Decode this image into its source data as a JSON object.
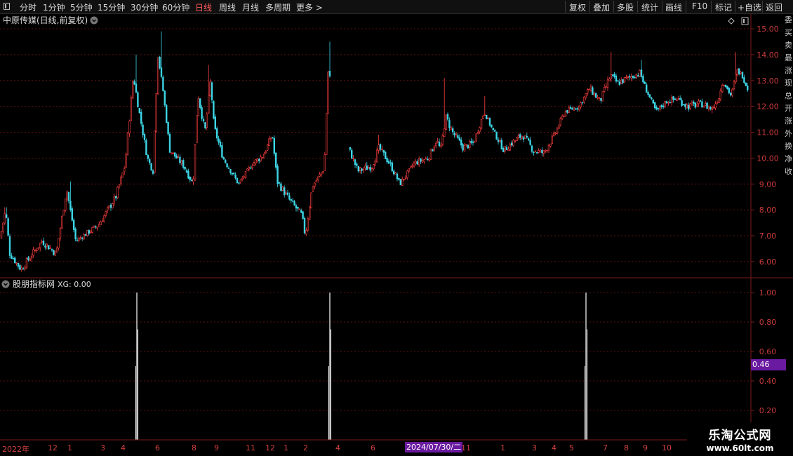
{
  "toolbar": {
    "left_items": [
      "分时",
      "1分钟",
      "5分钟",
      "15分钟",
      "30分钟",
      "60分钟",
      "日线",
      "周线",
      "月线",
      "多周期",
      "更多 >"
    ],
    "active": "日线",
    "right_items": [
      "复权",
      "叠加",
      "多股",
      "统计",
      "画线",
      "F10",
      "标记",
      "+自选",
      "返回"
    ]
  },
  "main_panel": {
    "title": "中原传媒(日线,前复权)",
    "y_ticks": [
      "15.00",
      "14.00",
      "13.00",
      "12.00",
      "11.00",
      "10.00",
      "9.00",
      "8.00",
      "7.00",
      "6.00"
    ]
  },
  "indicator_panel": {
    "title": "股朋指标网",
    "value_label": "XG: 0.00",
    "y_ticks": [
      "1.00",
      "0.80",
      "0.60",
      "0.40",
      "0.20"
    ],
    "cursor_value": "0.46"
  },
  "x_axis": {
    "labels": [
      "2022年",
      "12",
      "1",
      "3",
      "4",
      "6",
      "8",
      "9",
      "11",
      "12",
      "1",
      "2",
      "4",
      "6",
      "11",
      "1",
      "3",
      "4",
      "5",
      "7",
      "8",
      "9",
      "10"
    ],
    "cursor_date": "2024/07/30/二"
  },
  "right_side_labels": [
    "委",
    "买",
    "卖",
    "最",
    "涨",
    "现",
    "总",
    "开",
    "涨",
    "外",
    "换",
    "净",
    "收"
  ],
  "watermark": {
    "title": "乐淘公式网",
    "url": "www.60lt.com"
  },
  "colors": {
    "up": "#ff4040",
    "down": "#3cd6e6",
    "grid": "#5a1010",
    "signal": "#ffffff",
    "accent": "#6a1aa0"
  },
  "chart_data": [
    {
      "type": "candlestick",
      "title": "中原传媒(日线,前复权)",
      "ylim": [
        5.4,
        15.3
      ],
      "x_labels": [
        "2022年",
        "12",
        "1",
        "3",
        "4",
        "6",
        "8",
        "9",
        "11",
        "12",
        "1",
        "2",
        "4",
        "6",
        "11",
        "1",
        "3",
        "4",
        "5",
        "7",
        "8",
        "9",
        "10"
      ],
      "close_keypoints": [
        [
          0,
          6.9
        ],
        [
          8,
          8.0
        ],
        [
          14,
          6.3
        ],
        [
          30,
          5.7
        ],
        [
          60,
          6.8
        ],
        [
          80,
          6.3
        ],
        [
          95,
          8.8
        ],
        [
          108,
          6.8
        ],
        [
          140,
          7.4
        ],
        [
          165,
          8.5
        ],
        [
          178,
          9.7
        ],
        [
          190,
          13.2
        ],
        [
          197,
          12.0
        ],
        [
          210,
          10.0
        ],
        [
          218,
          9.5
        ],
        [
          225,
          14.0
        ],
        [
          232,
          12.7
        ],
        [
          242,
          10.3
        ],
        [
          262,
          9.7
        ],
        [
          275,
          9.0
        ],
        [
          282,
          12.5
        ],
        [
          292,
          11.0
        ],
        [
          300,
          13.0
        ],
        [
          305,
          11.2
        ],
        [
          318,
          10.0
        ],
        [
          340,
          9.0
        ],
        [
          360,
          9.8
        ],
        [
          375,
          10.1
        ],
        [
          388,
          10.9
        ],
        [
          395,
          9.1
        ],
        [
          412,
          8.4
        ],
        [
          430,
          7.8
        ],
        [
          435,
          7.0
        ],
        [
          445,
          8.9
        ],
        [
          462,
          9.6
        ],
        [
          468,
          13.6
        ],
        [
          475,
          12.0
        ],
        [
          488,
          11.0
        ],
        [
          495,
          10.5
        ],
        [
          510,
          9.5
        ],
        [
          530,
          9.7
        ],
        [
          540,
          10.4
        ],
        [
          555,
          9.8
        ],
        [
          570,
          9.0
        ],
        [
          590,
          9.8
        ],
        [
          610,
          10.0
        ],
        [
          622,
          10.7
        ],
        [
          628,
          10.3
        ],
        [
          635,
          11.6
        ],
        [
          645,
          11.0
        ],
        [
          660,
          10.4
        ],
        [
          675,
          10.6
        ],
        [
          690,
          11.8
        ],
        [
          700,
          11.2
        ],
        [
          718,
          10.3
        ],
        [
          730,
          10.6
        ],
        [
          745,
          10.9
        ],
        [
          760,
          10.3
        ],
        [
          775,
          10.2
        ],
        [
          790,
          10.9
        ],
        [
          805,
          11.8
        ],
        [
          825,
          12.0
        ],
        [
          840,
          12.7
        ],
        [
          855,
          12.2
        ],
        [
          870,
          13.2
        ],
        [
          880,
          12.9
        ],
        [
          895,
          13.1
        ],
        [
          912,
          13.3
        ],
        [
          920,
          12.7
        ],
        [
          935,
          11.8
        ],
        [
          950,
          12.2
        ],
        [
          965,
          12.3
        ],
        [
          980,
          12.0
        ],
        [
          1000,
          12.1
        ],
        [
          1015,
          11.9
        ],
        [
          1025,
          12.4
        ],
        [
          1030,
          13.0
        ],
        [
          1042,
          12.4
        ],
        [
          1050,
          13.4
        ],
        [
          1058,
          13.2
        ],
        [
          1065,
          12.7
        ]
      ],
      "spike_highs": [
        [
          8,
          8.1
        ],
        [
          100,
          9.1
        ],
        [
          195,
          14.0
        ],
        [
          230,
          14.9
        ],
        [
          298,
          13.6
        ],
        [
          470,
          14.5
        ],
        [
          540,
          10.9
        ],
        [
          633,
          13.1
        ],
        [
          690,
          12.4
        ],
        [
          870,
          14.1
        ],
        [
          913,
          13.8
        ],
        [
          1048,
          14.1
        ]
      ]
    },
    {
      "type": "bar",
      "title": "股朋指标网",
      "series_name": "XG",
      "ylim": [
        0,
        1.05
      ],
      "signals": [
        {
          "x": 195,
          "value": 1.0
        },
        {
          "x": 470,
          "value": 1.0
        },
        {
          "x": 835,
          "value": 1.0
        }
      ],
      "cursor_value": 0.46
    }
  ]
}
